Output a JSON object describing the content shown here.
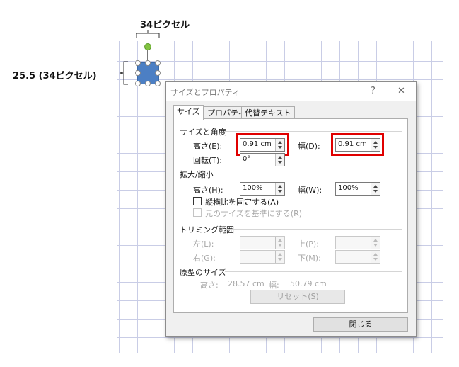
{
  "annotations": {
    "width_label": "34ピクセル",
    "height_label": "25.5 (34ピクセル)"
  },
  "dialog": {
    "title": "サイズとプロパティ",
    "help": "?",
    "close": "✕",
    "tabs": [
      "サイズ",
      "プロパティ",
      "代替テキスト"
    ],
    "size_angle": {
      "header": "サイズと角度",
      "height_label": "高さ(E):",
      "height_value": "0.91 cm",
      "width_label": "幅(D):",
      "width_value": "0.91 cm",
      "rotation_label": "回転(T):",
      "rotation_value": "0°"
    },
    "scale": {
      "header": "拡大/縮小",
      "height_label": "高さ(H):",
      "height_value": "100%",
      "width_label": "幅(W):",
      "width_value": "100%",
      "lock_aspect": "縦横比を固定する(A)",
      "relative_original": "元のサイズを基準にする(R)"
    },
    "crop": {
      "header": "トリミング範囲",
      "left": "左(L):",
      "top": "上(P):",
      "right": "右(G):",
      "bottom": "下(M):"
    },
    "original": {
      "header": "原型のサイズ",
      "height_label": "高さ:",
      "height_value": "28.57 cm",
      "width_label": "幅:",
      "width_value": "50.79 cm",
      "reset": "リセット(S)"
    },
    "close_button": "閉じる"
  },
  "colors": {
    "shape_fill": "#4c7fc4",
    "highlight": "#e00000",
    "rotation_handle": "#82c341"
  }
}
